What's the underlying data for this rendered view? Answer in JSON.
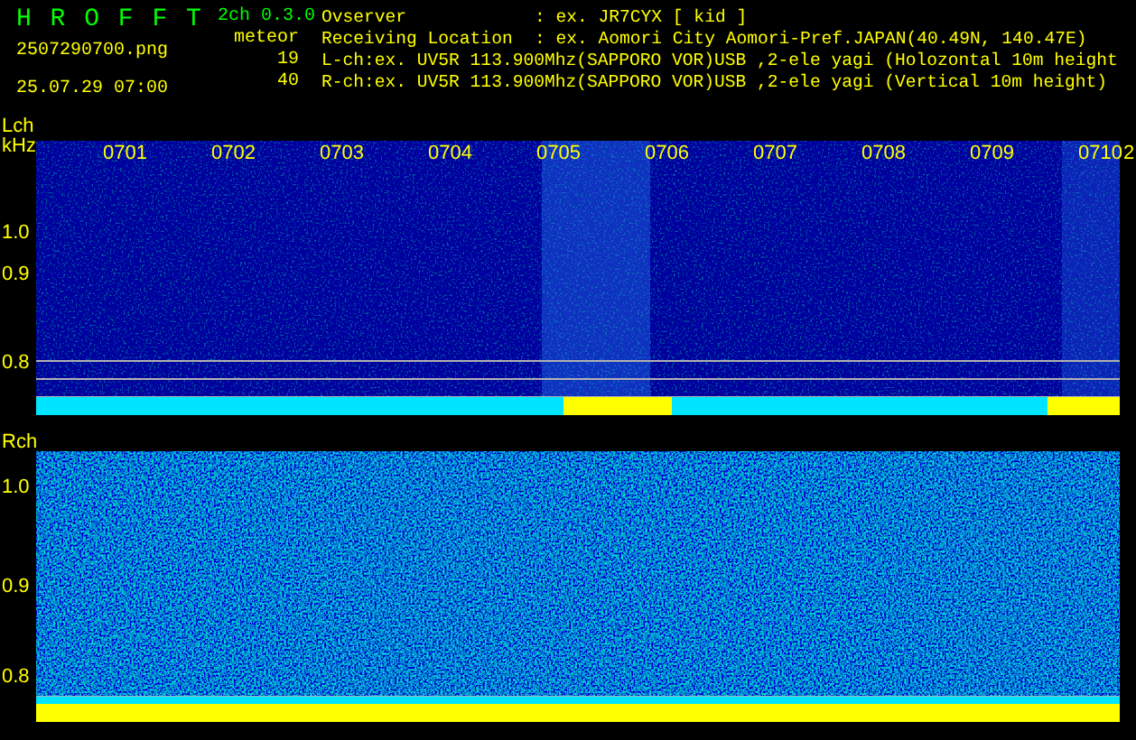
{
  "app": {
    "title": "H R O F F T",
    "version": "2ch 0.3.0"
  },
  "file_name": "2507290700.png",
  "datetime": "25.07.29 07:00",
  "meteor": {
    "label": "meteor",
    "counts": [
      "19",
      "40"
    ]
  },
  "info": [
    {
      "label": "Ovserver",
      "value": ": ex. JR7CYX [ kid ]"
    },
    {
      "label": "Receiving Location",
      "value": ": ex. Aomori City Aomori-Pref.JAPAN(40.49N, 140.47E)"
    }
  ],
  "channel_lines": [
    "L-ch:ex. UV5R 113.900Mhz(SAPPORO VOR)USB ,2-ele yagi (Holozontal 10m height",
    "R-ch:ex. UV5R 113.900Mhz(SAPPORO VOR)USB ,2-ele yagi (Vertical 10m height)"
  ],
  "panels": [
    {
      "kind": "lch",
      "channel": "Lch",
      "unit": "kHz",
      "yticks": [
        "1.0",
        "0.9",
        "0.8"
      ],
      "time_labels": [
        "0701",
        "0702",
        "0703",
        "0704",
        "0705",
        "0706",
        "0707",
        "0708",
        "0709",
        "0710",
        "2"
      ]
    },
    {
      "kind": "rch",
      "channel": "Rch",
      "yticks": [
        "1.0",
        "0.9",
        "0.8"
      ]
    }
  ]
}
